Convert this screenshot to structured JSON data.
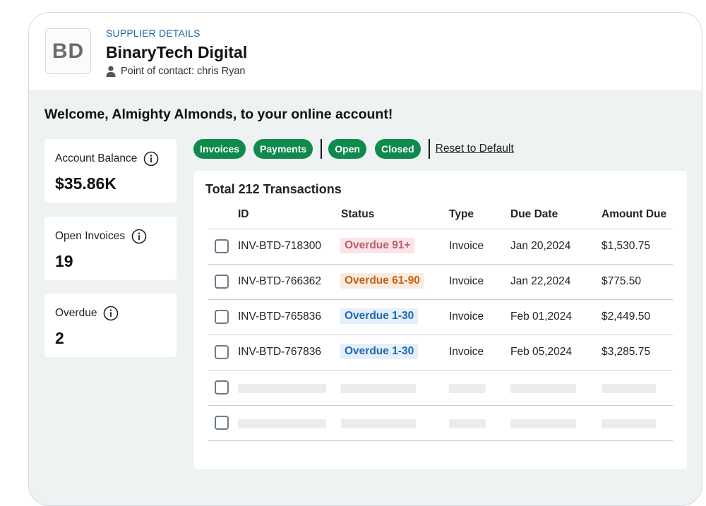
{
  "supplier": {
    "section_label": "SUPPLIER DETAILS",
    "logo_initials": "BD",
    "name": "BinaryTech Digital",
    "contact": "Point of contact: chris Ryan"
  },
  "welcome": "Welcome, Almighty Almonds, to your online account!",
  "stats": [
    {
      "label": "Account Balance",
      "value": "$35.86K"
    },
    {
      "label": "Open Invoices",
      "value": "19"
    },
    {
      "label": "Overdue",
      "value": "2"
    }
  ],
  "filters": {
    "invoices": "Invoices",
    "payments": "Payments",
    "open": "Open",
    "closed": "Closed",
    "reset": "Reset to Default"
  },
  "table": {
    "total": "Total 212 Transactions",
    "headers": {
      "id": "ID",
      "status": "Status",
      "type": "Type",
      "due": "Due Date",
      "amount": "Amount Due"
    },
    "rows": [
      {
        "id": "INV-BTD-718300",
        "status": "Overdue 91+",
        "type": "Invoice",
        "due": "Jan 20,2024",
        "amount": "$1,530.75"
      },
      {
        "id": "INV-BTD-766362",
        "status": "Overdue 61-90",
        "type": "Invoice",
        "due": "Jan 22,2024",
        "amount": "$775.50"
      },
      {
        "id": "INV-BTD-765836",
        "status": "Overdue 1-30",
        "type": "Invoice",
        "due": "Feb 01,2024",
        "amount": "$2,449.50"
      },
      {
        "id": "INV-BTD-767836",
        "status": "Overdue 1-30",
        "type": "Invoice",
        "due": "Feb 05,2024",
        "amount": "$3,285.75"
      }
    ]
  },
  "colors": {
    "brand_green": "#0d8a4c",
    "label_blue": "#1f67b1",
    "overdue_91_text": "#b8616e",
    "overdue_91_bg": "#fbe4e7",
    "overdue_61_text": "#c0621a",
    "overdue_61_bg": "#fcebdc",
    "overdue_1_text": "#1f67b1",
    "overdue_1_bg": "#e4effa"
  }
}
